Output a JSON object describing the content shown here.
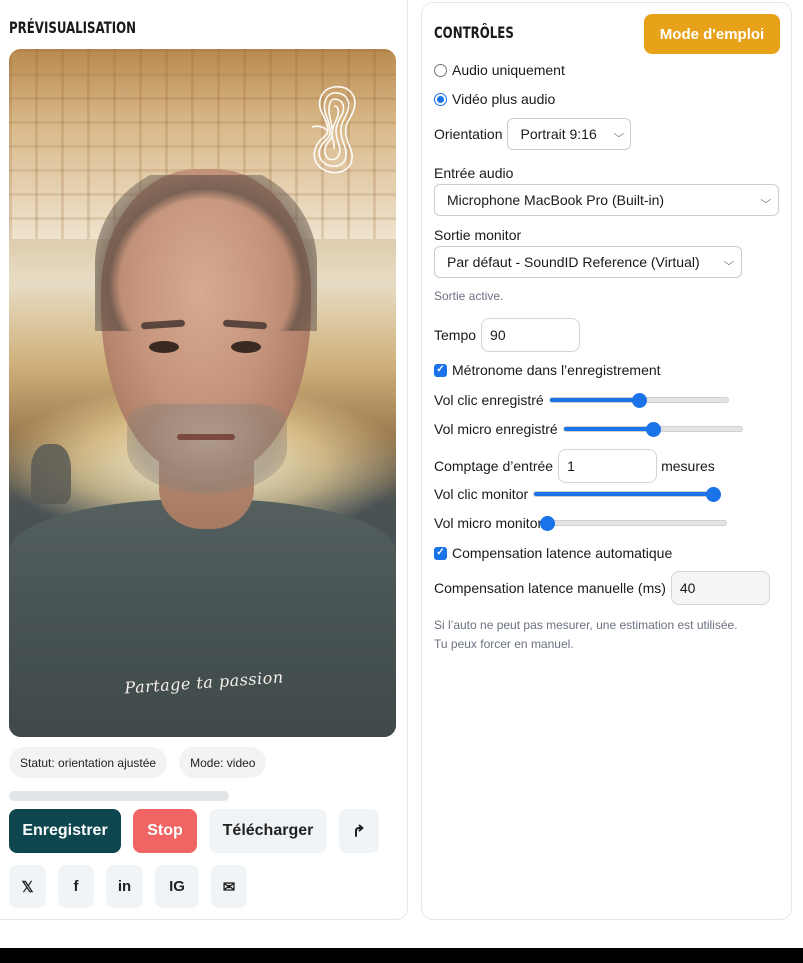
{
  "preview_panel": {
    "title": "Prévisualisation",
    "watermark": "Partage ta passion",
    "status_badge": "Statut: orientation ajustée",
    "mode_badge": "Mode: video",
    "progress": 0.0,
    "buttons": {
      "record": "Enregistrer",
      "stop": "Stop",
      "download": "Télécharger",
      "share": "↑"
    },
    "socials": [
      {
        "label": "𝕏",
        "icon": "x-icon"
      },
      {
        "label": "f",
        "icon": "facebook-icon"
      },
      {
        "label": "in",
        "icon": "linkedin-icon"
      },
      {
        "label": "IG",
        "icon": "instagram-icon"
      },
      {
        "label": "✉",
        "icon": "mail-icon"
      }
    ]
  },
  "controls_panel": {
    "title": "Contrôles",
    "help_button": "Mode d'emploi",
    "mode_audio_only": "Audio uniquement",
    "mode_video_audio": "Vidéo plus audio",
    "selected_mode": "Vidéo plus audio",
    "orientation_label": "Orientation",
    "orientation_value": "Portrait 9:16",
    "audio_input_label": "Entrée audio",
    "audio_input_value": "Microphone MacBook Pro (Built-in)",
    "monitor_output_label": "Sortie monitor",
    "monitor_output_value": "Par défaut - SoundID Reference (Virtual)",
    "output_status": "Sortie active.",
    "tempo_label": "Tempo",
    "tempo_value": "90",
    "metronome_label": "Métronome dans l’enregistrement",
    "metronome_checked": true,
    "vol_click_recorded_label": "Vol clic enregistré",
    "vol_click_recorded": 0.5,
    "vol_mic_recorded_label": "Vol micro enregistré",
    "vol_mic_recorded": 0.5,
    "count_in_label": "Comptage d’entrée",
    "count_in_value": "1",
    "count_in_unit": "mesures",
    "vol_click_monitor_label": "Vol clic monitor",
    "vol_click_monitor": 1.0,
    "vol_mic_monitor_label": "Vol micro monitor",
    "vol_mic_monitor": 0.0,
    "auto_latency_label": "Compensation latence automatique",
    "auto_latency_checked": true,
    "manual_latency_label": "Compensation latence manuelle (ms)",
    "manual_latency_value": "40",
    "latency_hint_line1": "Si l’auto ne peut pas mesurer, une estimation est utilisée.",
    "latency_hint_line2": "Tu peux forcer en manuel."
  },
  "colors": {
    "record": "#0e4650",
    "stop": "#f06464",
    "help": "#e8a21a",
    "accent": "#1a73e8"
  }
}
